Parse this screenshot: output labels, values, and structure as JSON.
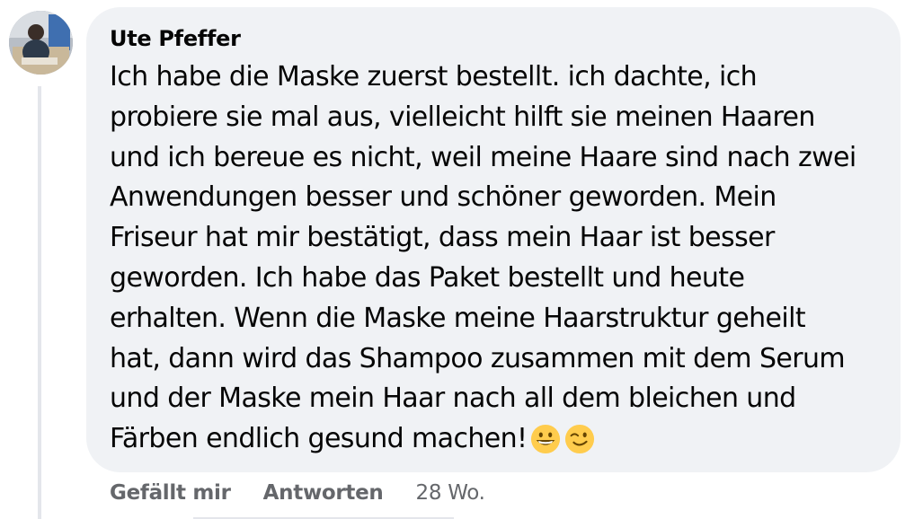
{
  "comment": {
    "author": "Ute Pfeffer",
    "avatar_icon": "profile-photo",
    "lines": [
      "Ich habe die Maske zuerst bestellt. ich dachte, ich",
      "probiere sie mal aus, vielleicht hilft sie meinen Haaren",
      "und ich bereue es nicht, weil meine Haare sind nach zwei",
      "Anwendungen besser und schöner geworden. Mein",
      "Friseur hat mir bestätigt, dass mein Haar ist besser",
      "geworden. Ich habe das Paket bestellt und heute",
      "erhalten. Wenn die Maske meine Haarstruktur geheilt",
      "hat, dann wird das Shampoo zusammen mit dem Serum",
      "und der Maske mein Haar nach all dem bleichen und",
      "Färben endlich gesund machen!"
    ],
    "emojis": [
      "grinning-face",
      "winking-face"
    ]
  },
  "actions": {
    "like_label": "Gefällt mir",
    "reply_label": "Antworten",
    "timestamp": "28 Wo."
  },
  "colors": {
    "bubble": "#f0f2f5",
    "text": "#050505",
    "secondary": "#65676b",
    "emoji": "#ffcc4d"
  }
}
